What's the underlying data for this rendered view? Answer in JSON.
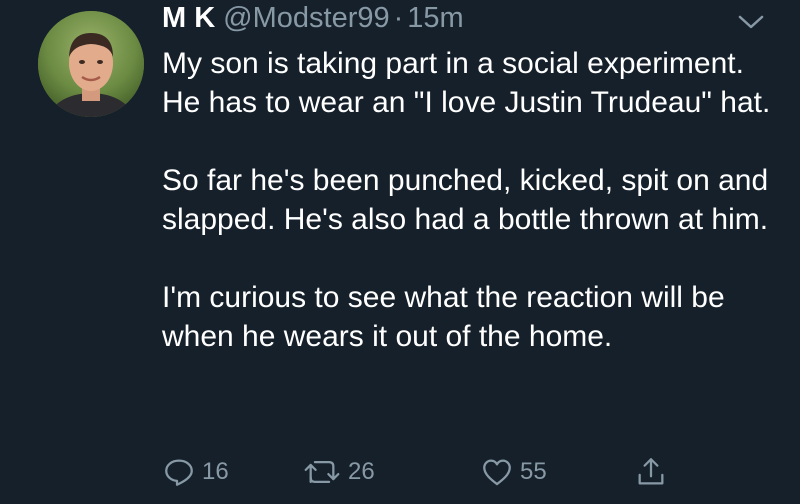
{
  "author": {
    "name": "M K",
    "handle": "@Modster99",
    "separator": "·",
    "time": "15m"
  },
  "tweet": {
    "paragraphs": [
      "My son is taking part in a social experiment. He has to wear an \"I love Justin Trudeau\" hat.",
      "So far he's been punched, kicked, spit on and slapped. He's also had a bottle thrown at him.",
      "I'm curious to see what the reaction will be when he wears it out of the home."
    ]
  },
  "actions": {
    "replies": "16",
    "retweets": "26",
    "likes": "55"
  },
  "icons": {
    "reply": "reply-icon",
    "retweet": "retweet-icon",
    "like": "heart-icon",
    "share": "share-icon",
    "menu": "chevron-down-icon"
  },
  "colors": {
    "background": "#15202b",
    "text": "#ffffff",
    "secondary": "#8899a6"
  }
}
